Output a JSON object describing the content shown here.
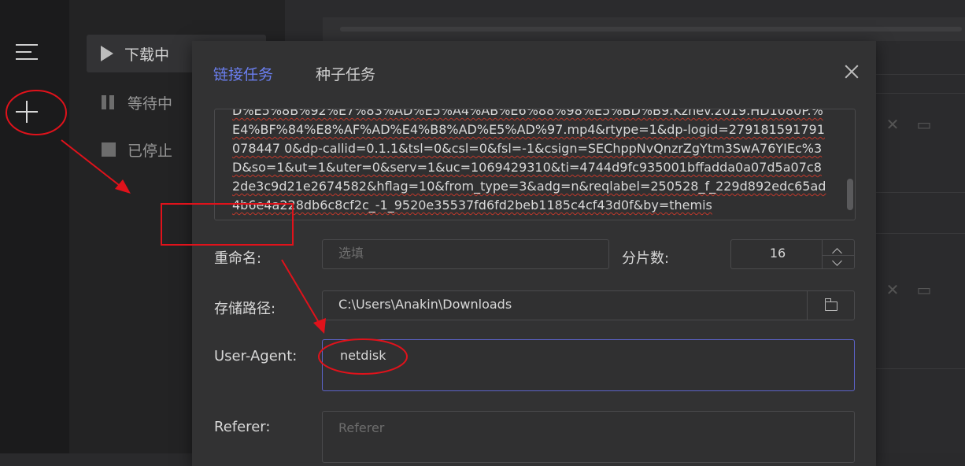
{
  "sidebar": {
    "title_partial": "",
    "items": [
      {
        "label": "下载中",
        "icon": "play-icon"
      },
      {
        "label": "等待中",
        "icon": "pause-icon"
      },
      {
        "label": "已停止",
        "icon": "stop-icon"
      }
    ]
  },
  "dialog": {
    "tabs": [
      {
        "label": "链接任务",
        "active": true
      },
      {
        "label": "种子任务",
        "active": false
      }
    ],
    "url_text": "D%E5%8B%92%E7%83%AD%E5%A4%AB%E6%88%98%E5%BD%B9.Kznev.2019.HD1080P.%E4%BF%84%E8%AF%AD%E4%B8%AD%E5%AD%97.mp4&rtype=1&dp-logid=279181591791078447 0&dp-callid=0.1.1&tsl=0&csl=0&fsl=-1&csign=SEChppNvQnzrZgYtm3SwA76YIEc%3D&so=1&ut=1&uter=0&serv=1&uc=1069429310&ti=4744d9fc935001bffadda0a07d5a07c82de3c9d21e2674582&hflag=10&from_type=3&adg=n&reqlabel=250528_f_229d892edc65ad4b6e4a228db6c8cf2c_-1_9520e35537fd6fd2beb1185c4cf43d0f&by=themis",
    "rename_label": "重命名:",
    "rename_placeholder": "选填",
    "segments_label": "分片数:",
    "segments_value": "16",
    "save_path_label": "存储路径:",
    "save_path_value": "C:\\Users\\Anakin\\Downloads",
    "user_agent_label": "User-Agent:",
    "user_agent_value": "netdisk",
    "referer_label": "Referer:",
    "referer_placeholder": "Referer"
  },
  "colors": {
    "accent": "#6b7ff0",
    "annotation": "#e0121b"
  }
}
